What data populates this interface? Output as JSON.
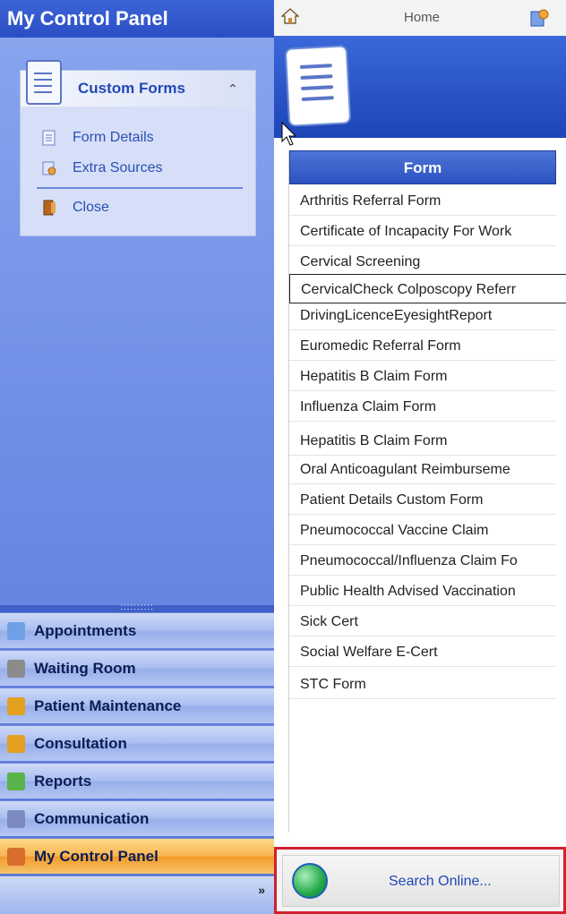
{
  "left_panel": {
    "title": "My Control Panel",
    "custom_forms": {
      "title": "Custom Forms",
      "collapse_glyph": "⌃",
      "items": [
        {
          "label": "Form Details",
          "icon": "form-details-icon"
        },
        {
          "label": "Extra Sources",
          "icon": "extra-sources-icon"
        },
        {
          "label": "Close",
          "icon": "close-door-icon"
        }
      ]
    },
    "splitter_grip": "::::::::::",
    "nav": [
      {
        "label": "Appointments",
        "icon": "appointments-icon",
        "color": "#6ea0e8"
      },
      {
        "label": "Waiting Room",
        "icon": "waiting-room-icon",
        "color": "#8b8b8b"
      },
      {
        "label": "Patient Maintenance",
        "icon": "patient-maintenance-icon",
        "color": "#e4a021"
      },
      {
        "label": "Consultation",
        "icon": "consultation-icon",
        "color": "#e4a021"
      },
      {
        "label": "Reports",
        "icon": "reports-icon",
        "color": "#58b34a"
      },
      {
        "label": "Communication",
        "icon": "communication-icon",
        "color": "#7b8bbf"
      },
      {
        "label": "My Control Panel",
        "icon": "control-panel-icon",
        "color": "#d86d2c"
      }
    ],
    "more_glyph": "»"
  },
  "right_panel": {
    "home_label": "Home",
    "grid_header": "Form",
    "forms": [
      "Arthritis Referral Form",
      "Certificate of Incapacity For Work",
      "Cervical Screening",
      "CervicalCheck Colposcopy Referr",
      "DrivingLicenceEyesightReport",
      "Euromedic Referral Form",
      "Hepatitis B Claim Form",
      "Influenza Claim Form",
      "Hepatitis B Claim Form",
      "Oral Anticoagulant Reimburseme",
      "Patient Details Custom Form",
      "Pneumococcal Vaccine Claim",
      "Pneumococcal/Influenza Claim Fo",
      "Public Health Advised Vaccination",
      "Sick Cert",
      "Social Welfare E-Cert",
      "STC Form"
    ],
    "selected_form": "CervicalCheck Colposcopy Referr",
    "search_label": "Search Online..."
  },
  "colors": {
    "left_header": "#2a4fc4",
    "active_nav": "#f7b550",
    "grid_header": "#2c52c0",
    "search_highlight": "#d21f2f"
  }
}
